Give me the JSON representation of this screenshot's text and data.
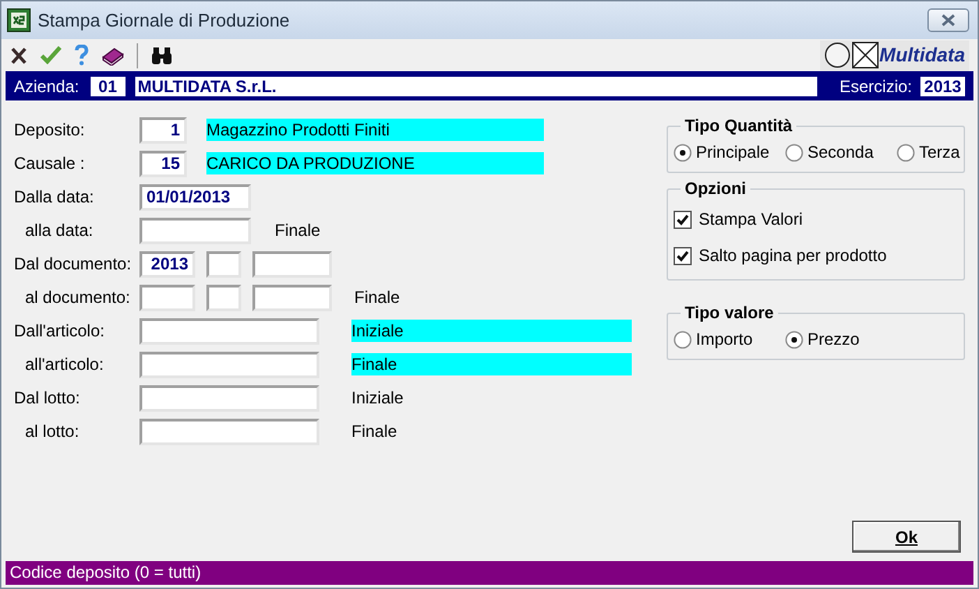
{
  "window": {
    "title": "Stampa Giornale di Produzione"
  },
  "logo": {
    "text": "Multidata"
  },
  "company_bar": {
    "label": "Azienda:",
    "code": "01",
    "name": "MULTIDATA S.r.L.",
    "year_label": "Esercizio:",
    "year": "2013"
  },
  "form": [
    {
      "label": "Deposito:",
      "indented": false,
      "fields": [
        {
          "kind": "code",
          "value": "1"
        }
      ],
      "note": {
        "text": "Magazzino Prodotti Finiti",
        "highlighted": true
      }
    },
    {
      "label": "Causale :",
      "indented": false,
      "fields": [
        {
          "kind": "code",
          "value": "15"
        }
      ],
      "note": {
        "text": "CARICO DA PRODUZIONE",
        "highlighted": true
      }
    },
    {
      "label": "Dalla data:",
      "indented": false,
      "fields": [
        {
          "kind": "date",
          "value": "01/01/2013"
        }
      ]
    },
    {
      "label": "alla data:",
      "indented": true,
      "fields": [
        {
          "kind": "date"
        }
      ],
      "note": {
        "text": "Finale",
        "highlighted": false
      }
    },
    {
      "label": "Dal documento:",
      "indented": false,
      "fields": [
        {
          "kind": "year",
          "value": "2013"
        },
        {
          "kind": "series"
        },
        {
          "kind": "number"
        }
      ]
    },
    {
      "label": "al documento:",
      "indented": true,
      "fields": [
        {
          "kind": "year"
        },
        {
          "kind": "series"
        },
        {
          "kind": "number"
        }
      ],
      "note": {
        "text": "Finale",
        "highlighted": false
      }
    },
    {
      "label": "Dall'articolo:",
      "indented": false,
      "fields": [
        {
          "kind": "article"
        }
      ],
      "note": {
        "text": "Iniziale",
        "highlighted": true
      }
    },
    {
      "label": "all'articolo:",
      "indented": true,
      "fields": [
        {
          "kind": "article"
        }
      ],
      "note": {
        "text": "Finale",
        "highlighted": true
      }
    },
    {
      "label": "Dal lotto:",
      "indented": false,
      "fields": [
        {
          "kind": "article"
        }
      ],
      "note": {
        "text": "Iniziale",
        "highlighted": false
      }
    },
    {
      "label": "al lotto:",
      "indented": true,
      "fields": [
        {
          "kind": "article"
        }
      ],
      "note": {
        "text": "Finale",
        "highlighted": false
      }
    }
  ],
  "panels": [
    {
      "title": "Tipo Quantità",
      "kind": "radio",
      "options": [
        {
          "label": "Principale",
          "selected": true
        },
        {
          "label": "Seconda",
          "selected": false
        },
        {
          "label": "Terza",
          "selected": false
        }
      ]
    },
    {
      "title": "Opzioni",
      "kind": "checkbox",
      "options": [
        {
          "label": "Stampa Valori",
          "checked": true
        },
        {
          "label": "Salto pagina per prodotto",
          "checked": true
        }
      ]
    },
    {
      "title": "Tipo valore",
      "kind": "radio",
      "options": [
        {
          "label": "Importo",
          "selected": false
        },
        {
          "label": "Prezzo",
          "selected": true
        }
      ]
    }
  ],
  "ok_button": {
    "label": "Ok"
  },
  "status_bar": {
    "text": "Codice deposito (0 = tutti)"
  }
}
